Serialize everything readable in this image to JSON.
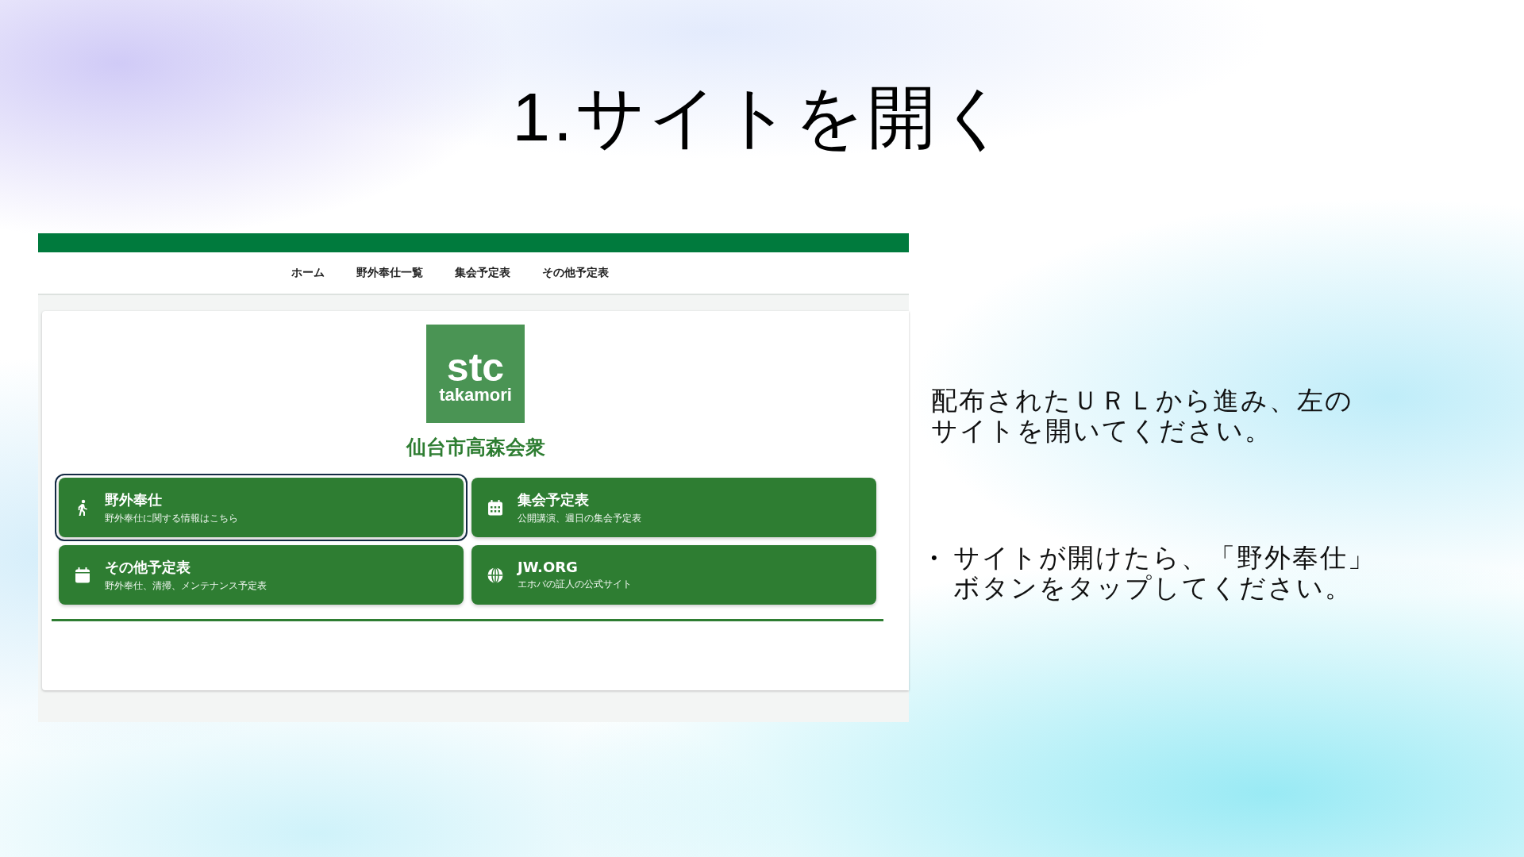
{
  "slide": {
    "title": "1.サイトを開く"
  },
  "website": {
    "nav": [
      {
        "label": "ホーム"
      },
      {
        "label": "野外奉仕一覧"
      },
      {
        "label": "集会予定表"
      },
      {
        "label": "その他予定表"
      }
    ],
    "logo": {
      "line_1": "stc",
      "line_2": "takamori"
    },
    "site_name": "仙台市高森会衆",
    "tiles": [
      {
        "title": "野外奉仕",
        "subtitle": "野外奉仕に関する情報はこちら",
        "focused": true
      },
      {
        "title": "集会予定表",
        "subtitle": "公開講演、週日の集会予定表",
        "focused": false
      },
      {
        "title": "その他予定表",
        "subtitle": "野外奉仕、清掃、メンテナンス予定表",
        "focused": false
      },
      {
        "title": "JW.ORG",
        "subtitle": "エホバの証人の公式サイト",
        "focused": false
      }
    ]
  },
  "notes": [
    {
      "lines": [
        "配布されたＵＲＬから進み、左の",
        "サイトを開いてください。"
      ]
    },
    {
      "bullet": "•",
      "lines": [
        "サイトが開けたら、「野外奉仕」",
        "ボタンをタップしてください。"
      ]
    }
  ]
}
